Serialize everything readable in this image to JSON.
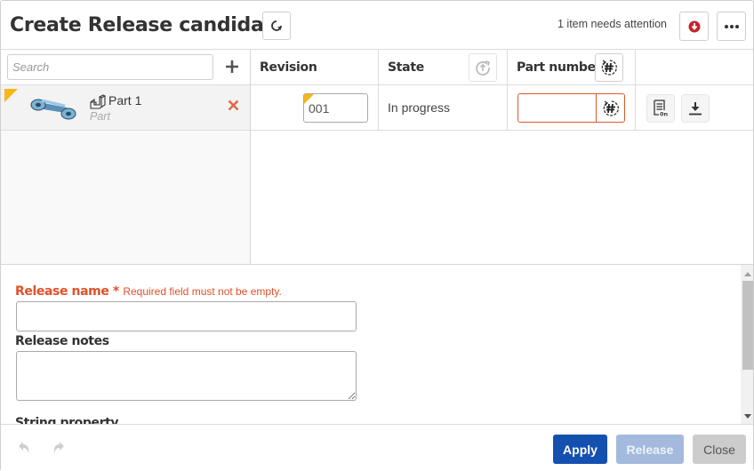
{
  "header": {
    "title": "Create Release candidate",
    "attention_text": "1 item needs attention"
  },
  "icons": {
    "refresh": "refresh-icon",
    "attention": "down-arrow-circle-icon",
    "more": "more-horizontal-icon",
    "add": "plus-icon",
    "remove": "close-icon",
    "part_type": "part-icon",
    "revision_reset": "revision-reset-icon",
    "generate_part_number": "generate-number-icon",
    "properties": "properties-icon",
    "download": "download-icon",
    "undo": "undo-icon",
    "redo": "redo-icon"
  },
  "search": {
    "placeholder": "Search",
    "value": ""
  },
  "items": [
    {
      "name": "Part 1",
      "type": "Part",
      "revision": "001",
      "state": "In progress",
      "part_number": ""
    }
  ],
  "columns": {
    "revision": "Revision",
    "state": "State",
    "part_number": "Part number"
  },
  "form": {
    "release_name": {
      "label": "Release name",
      "required_marker": "*",
      "error": "Required field must not be empty.",
      "value": ""
    },
    "release_notes": {
      "label": "Release notes",
      "value": ""
    },
    "string_property": {
      "label": "String property"
    }
  },
  "footer": {
    "apply_label": "Apply",
    "release_label": "Release",
    "close_label": "Close"
  },
  "colors": {
    "primary": "#1450b0",
    "primary_disabled": "#a3bade",
    "error": "#e0502a",
    "warning_flag": "#f8b718",
    "attention_icon": "#c4232b"
  }
}
